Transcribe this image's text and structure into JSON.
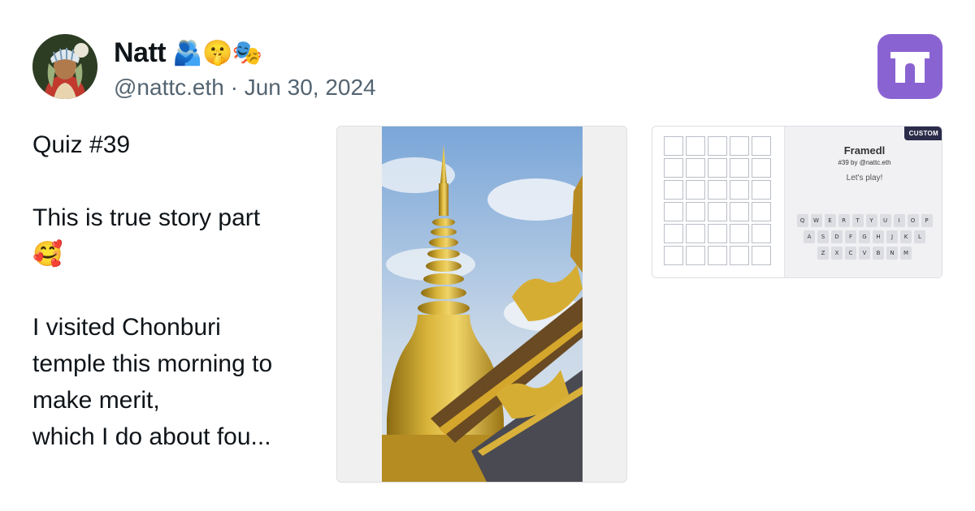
{
  "author": {
    "name": "Natt",
    "name_emoji": "🫂🤫🎭",
    "handle_date": "@nattc.eth · Jun 30, 2024"
  },
  "app_icon": "arch-logo-icon",
  "post": {
    "lines": [
      "Quiz #39",
      "",
      "This is true story part",
      "🥰",
      "",
      "I visited Chonburi",
      "temple this morning to",
      "make merit,",
      "which I do about fou..."
    ]
  },
  "frame": {
    "badge": "CUSTOM",
    "title": "Framedl",
    "subtitle": "#39 by @nattc.eth",
    "cta": "Let's play!",
    "keyboard": [
      [
        "Q",
        "W",
        "E",
        "R",
        "T",
        "Y",
        "U",
        "I",
        "O",
        "P"
      ],
      [
        "A",
        "S",
        "D",
        "F",
        "G",
        "H",
        "J",
        "K",
        "L"
      ],
      [
        "Z",
        "X",
        "C",
        "V",
        "B",
        "N",
        "M"
      ]
    ]
  },
  "colors": {
    "text": "#0f1419",
    "muted": "#536471",
    "brand": "#8a63d2",
    "badge": "#2b2b4a"
  }
}
